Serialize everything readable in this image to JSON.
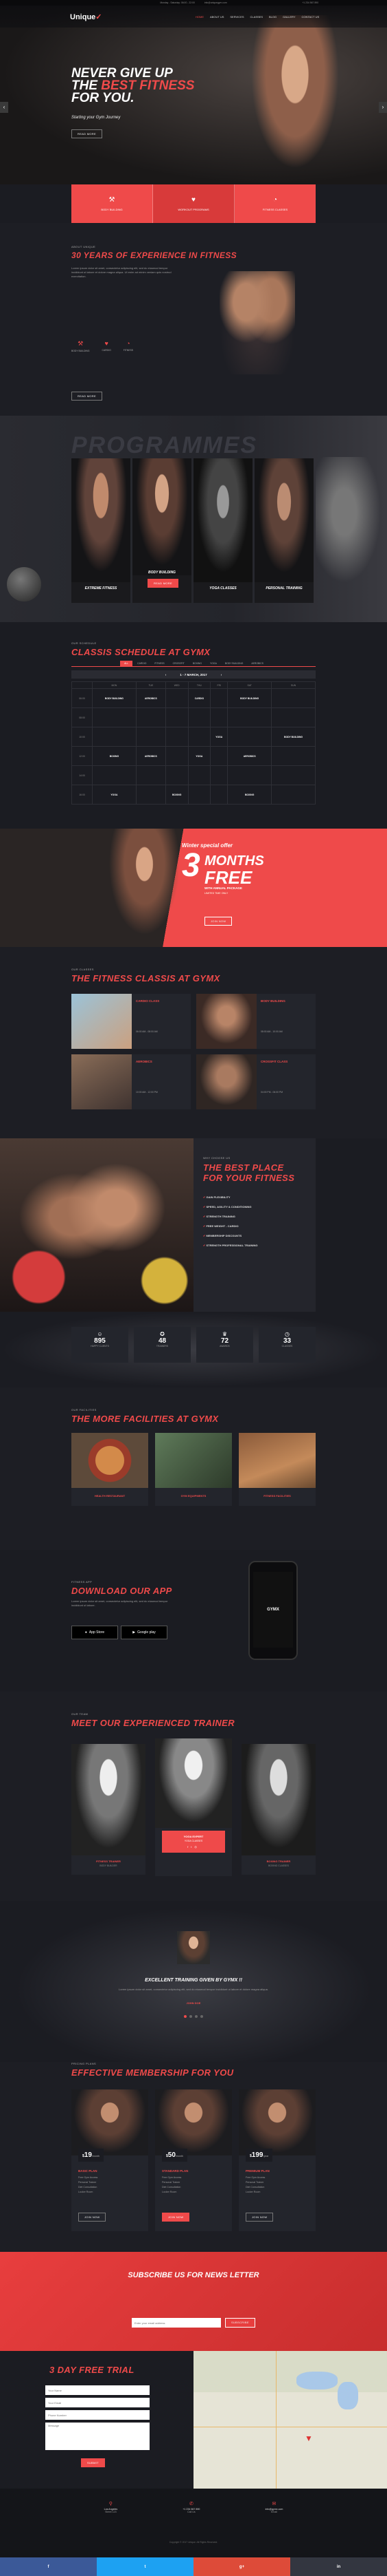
{
  "topbar": {
    "logo": "Unique",
    "logo_mark": "✓",
    "info": [
      "Monday - Saturday: 06:00 - 22:00",
      "info@uniquegym.com"
    ],
    "phone": "+1 234 567 890",
    "nav": [
      "HOME",
      "ABOUT US",
      "SERVICES",
      "CLASSES",
      "BLOG",
      "GALLERY",
      "CONTACT US"
    ]
  },
  "hero": {
    "line1": "NEVER GIVE UP",
    "line2_a": "THE ",
    "line2_b": "BEST FITNESS",
    "line3": "FOR YOU.",
    "tagline": "Starting your Gym Journey",
    "cta": "READ MORE"
  },
  "features": [
    {
      "icon": "dumbbell-icon",
      "label": "BODY BUILDING"
    },
    {
      "icon": "heart-icon",
      "label": "WORKOUT PROGRAMS"
    },
    {
      "icon": "timer-icon",
      "label": "FITNESS CLASSES"
    }
  ],
  "about": {
    "kicker": "ABOUT UNIQUE",
    "title": "30 YEARS OF EXPERIENCE IN FITNESS",
    "text": "Lorem ipsum dolor sit amet, consectetur adipiscing elit, sed do eiusmod tempor incididunt ut labore et dolore magna aliqua. Ut enim ad minim veniam quis nostrud exercitation.",
    "icons": [
      "BODY BUILDING",
      "CARDIO",
      "FITNESS"
    ],
    "cta": "READ MORE"
  },
  "programmes": {
    "watermark": "PROGRAMMES",
    "items": [
      "EXTREME FITNESS",
      "BODY BUILDING",
      "YOGA CLASSES",
      "PERSONAL TRAINING"
    ],
    "cta": "READ MORE"
  },
  "schedule": {
    "kicker": "OUR SCHEDULE",
    "title": "CLASSIS SCHEDULE AT GYMX",
    "tabs": [
      "ALL",
      "CARDIO",
      "FITNESS",
      "CROSSFIT",
      "BOXING",
      "YOGA",
      "BODY BUILDING",
      "AEROBICS"
    ],
    "month": "1 - 7 MARCH, 2017",
    "days": [
      "MON",
      "TUE",
      "WED",
      "THU",
      "FRI",
      "SAT",
      "SUN"
    ],
    "times": [
      "06:00",
      "08:00",
      "10:00",
      "12:00",
      "14:00",
      "16:00"
    ],
    "cells": [
      [
        "BODY BUILDING",
        "AEROBICS",
        "",
        "CARDIO",
        "",
        "BODY BUILDING",
        ""
      ],
      [
        "",
        "",
        "",
        "",
        "",
        "",
        ""
      ],
      [
        "",
        "",
        "",
        "",
        "YOGA",
        "",
        "BODY BUILDING"
      ],
      [
        "BOXING",
        "AEROBICS",
        "",
        "YOGA",
        "",
        "AEROBICS",
        ""
      ],
      [
        "",
        "",
        "",
        "",
        "",
        "",
        ""
      ],
      [
        "YOGA",
        "",
        "BOXING",
        "",
        "",
        "BOXING",
        ""
      ]
    ]
  },
  "offer": {
    "script": "Winter special offer",
    "big": "3",
    "big2": "MONTHS",
    "big3": "FREE",
    "sub": "WITH ANNUAL PACKAGE",
    "small": "LIMITED TIME ONLY",
    "cta": "JOIN NOW"
  },
  "classes": {
    "kicker": "OUR CLASSES",
    "title": "THE FITNESS CLASSIS AT GYMX",
    "items": [
      {
        "name": "CARDIO CLASS",
        "time": "06:00 AM - 08:00 AM"
      },
      {
        "name": "BODY BUILDING",
        "time": "08:00 AM - 10:00 AM"
      },
      {
        "name": "AEROBICS",
        "time": "10:00 AM - 12:00 PM"
      },
      {
        "name": "CROSSFIT CLASS",
        "time": "04:00 PM - 06:00 PM"
      }
    ]
  },
  "best": {
    "kicker": "WHY CHOOSE US",
    "title1": "THE BEST PLACE",
    "title2": "FOR YOUR FITNESS",
    "points": [
      "GAIN FLEXIBILITY",
      "SPEED, AGILITY & CONDITIONING",
      "STRENGTH TRAINING",
      "FREE WEIGHT - CARDIO",
      "MEMBERSHIP DISCOUNTS",
      "STRENGTH PROFESSIONAL TRAINING"
    ]
  },
  "stats": [
    {
      "icon": "user-icon",
      "num": "895",
      "label": "HAPPY CLIENTS"
    },
    {
      "icon": "medal-icon",
      "num": "48",
      "label": "TRAINERS"
    },
    {
      "icon": "trophy-icon",
      "num": "72",
      "label": "AWARDS"
    },
    {
      "icon": "clock-icon",
      "num": "33",
      "label": "CLASSES"
    }
  ],
  "facilities": {
    "kicker": "OUR FACILITIES",
    "title": "THE MORE FACILITIES AT GYMX",
    "items": [
      "HEALTH RESTAURANT",
      "GYM EQUIPMENTS",
      "FITNESS FACILITIES"
    ]
  },
  "app": {
    "kicker": "FITNESS APP",
    "title": "DOWNLOAD OUR APP",
    "text": "Lorem ipsum dolor sit amet, consectetur adipiscing elit, sed do eiusmod tempor incididunt ut labore.",
    "appstore": "App Store",
    "googleplay": "Google play",
    "phone_logo": "GYMX"
  },
  "trainers": {
    "kicker": "OUR TEAM",
    "title": "MEET OUR EXPERIENCED TRAINER",
    "items": [
      {
        "name": "FITNESS TRAINER",
        "role": "BODY BUILDER"
      },
      {
        "name": "YOGA EXPERT",
        "role": "YOGA CLASSES"
      },
      {
        "name": "BOXING TRAINER",
        "role": "BOXING CLASSES"
      }
    ]
  },
  "testimonial": {
    "title": "EXCELLENT TRAINING GIVEN BY GYMX !!",
    "text": "Lorem ipsum dolor sit amet, consectetur adipiscing elit, sed do eiusmod tempor incididunt ut labore et dolore magna aliqua.",
    "name": "JOHN DOE"
  },
  "membership": {
    "kicker": "PRICING PLANS",
    "title": "EFFECTIVE MEMBERSHIP FOR YOU",
    "plans": [
      {
        "price": "19",
        "per": "/month",
        "name": "BASIC PLAN",
        "cta": "JOIN NOW"
      },
      {
        "price": "50",
        "per": "/month",
        "name": "STANDARD PLAN",
        "cta": "JOIN NOW"
      },
      {
        "price": "199",
        "per": "/year",
        "name": "PREMIUM PLAN",
        "cta": "JOIN NOW"
      }
    ],
    "features": [
      "Free Gym Access",
      "Personal Trainer",
      "Diet Consultation",
      "Locker Room"
    ]
  },
  "newsletter": {
    "title": "SUBSCRIBE US FOR NEWS LETTER",
    "placeholder": "Enter your email address",
    "cta": "SUBSCRIBE"
  },
  "trial": {
    "title": "3 DAY FREE TRIAL",
    "fields": [
      "Your Name",
      "Your Email",
      "Phone Number",
      "Message"
    ],
    "cta": "SUBMIT"
  },
  "footer": {
    "contacts": [
      {
        "icon": "map-pin-icon",
        "line1": "Los Angeles",
        "line2": "Street 123"
      },
      {
        "icon": "phone-icon",
        "line1": "+1 234 567 890",
        "line2": "Call Us"
      },
      {
        "icon": "mail-icon",
        "line1": "info@gymx.com",
        "line2": "Email"
      }
    ],
    "copyright": "Copyright © 2017 Unique. All Rights Reserved."
  },
  "social": [
    {
      "icon": "facebook-icon",
      "glyph": "f",
      "color": "#3b5998"
    },
    {
      "icon": "twitter-icon",
      "glyph": "t",
      "color": "#1da1f2"
    },
    {
      "icon": "google-plus-icon",
      "glyph": "g+",
      "color": "#dd4b39"
    },
    {
      "icon": "linkedin-icon",
      "glyph": "in",
      "color": "#333640"
    }
  ]
}
